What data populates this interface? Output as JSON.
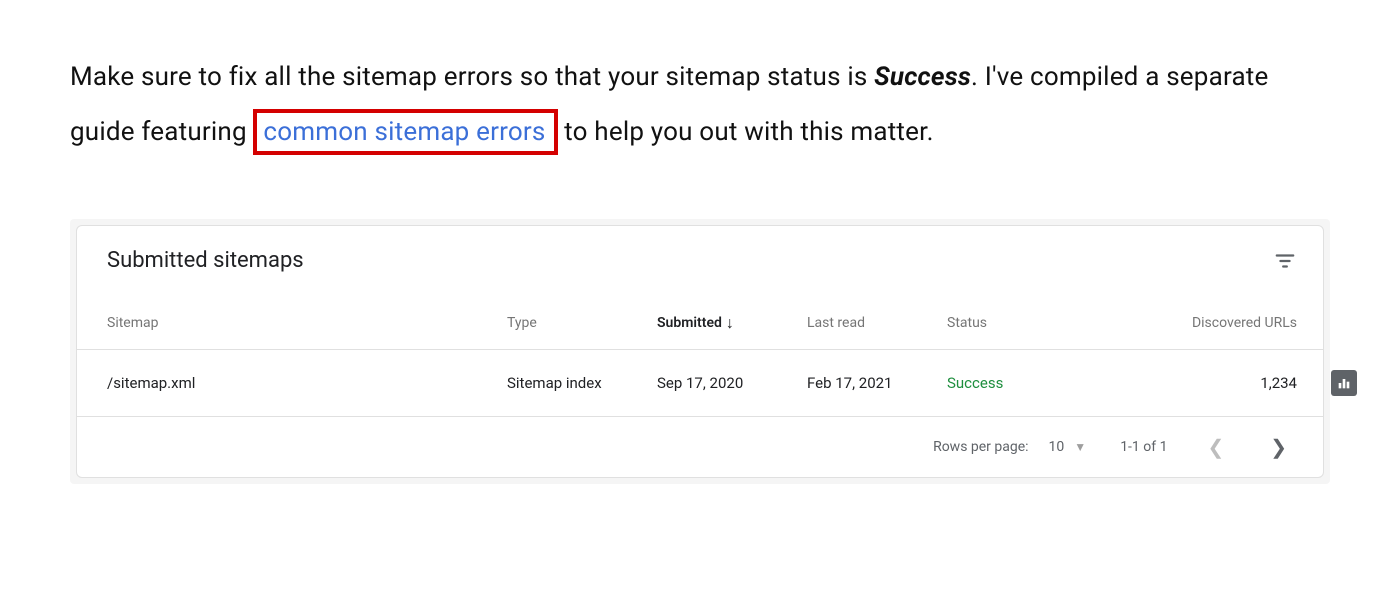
{
  "intro": {
    "part1": "Make sure to fix all the sitemap errors so that your sitemap status is ",
    "success_word": "Success",
    "part2": ". I've compiled a separate guide featuring ",
    "link_text": "common sitemap errors",
    "part3": " to help you out with this matter."
  },
  "panel": {
    "title": "Submitted sitemaps",
    "columns": {
      "sitemap": "Sitemap",
      "type": "Type",
      "submitted": "Submitted",
      "last_read": "Last read",
      "status": "Status",
      "discovered": "Discovered URLs"
    },
    "rows": [
      {
        "sitemap": "/sitemap.xml",
        "type": "Sitemap index",
        "submitted": "Sep 17, 2020",
        "last_read": "Feb 17, 2021",
        "status": "Success",
        "discovered": "1,234"
      }
    ],
    "pagination": {
      "rows_per_page_label": "Rows per page:",
      "rows_per_page_value": "10",
      "range": "1-1 of 1"
    }
  }
}
